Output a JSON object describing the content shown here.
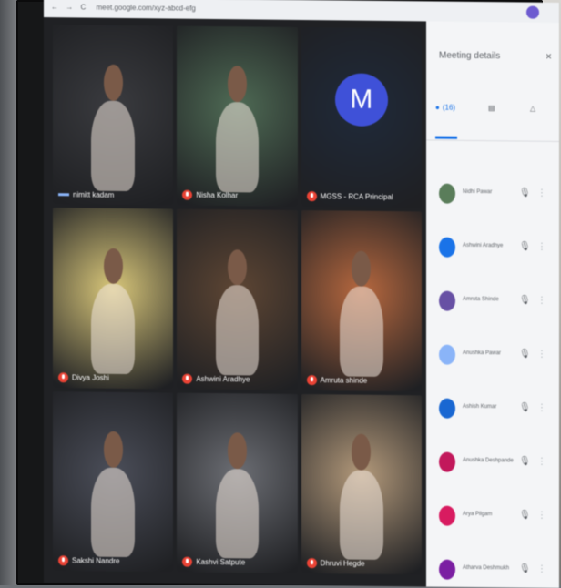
{
  "browser": {
    "nav_icons": "← → C",
    "url": "meet.google.com/xyz-abcd-efg",
    "profile_color": "#6d5bd0"
  },
  "meeting": {
    "tiles": [
      {
        "label": "nimitt kadam",
        "type": "video",
        "bg": "#3a3b3f"
      },
      {
        "label": "Nisha Kolhar",
        "type": "video",
        "bg": "#4f6b55"
      },
      {
        "label": "MGSS - RCA Principal",
        "type": "avatar",
        "initial": "M",
        "bg": "#1f2a3a",
        "avatar_color": "#3f51d8"
      },
      {
        "label": "Divya Joshi",
        "type": "video",
        "bg": "#d9c77a"
      },
      {
        "label": "Ashwini Aradhye",
        "type": "video",
        "bg": "#5e4634"
      },
      {
        "label": "Amruta shinde",
        "type": "video",
        "bg": "#b7683f"
      },
      {
        "label": "Sakshi Nandre",
        "type": "video",
        "bg": "#4b4e59"
      },
      {
        "label": "Kashvi Satpute",
        "type": "video",
        "bg": "#6c6e74"
      },
      {
        "label": "Dhruvi Hegde",
        "type": "video",
        "bg": "#b49a7b"
      }
    ]
  },
  "panel": {
    "title": "Meeting details",
    "close_icon": "close-icon",
    "tabs": [
      {
        "icon": "people-icon",
        "label": "(16)"
      },
      {
        "icon": "chat-icon",
        "label": "▤"
      },
      {
        "icon": "activities-icon",
        "label": "△"
      }
    ],
    "participants": [
      {
        "name": "Nidhi Pawar",
        "color": "#5a7d5a"
      },
      {
        "name": "Ashwini Aradhye",
        "color": "#1a73e8"
      },
      {
        "name": "Amruta Shinde",
        "color": "#6750a4"
      },
      {
        "name": "Anushka Pawar",
        "color": "#8ab4f8"
      },
      {
        "name": "Ashish Kumar",
        "color": "#1967d2"
      },
      {
        "name": "Anushka Deshpande",
        "color": "#c2185b"
      },
      {
        "name": "Arya Pilgam",
        "color": "#d81b60"
      },
      {
        "name": "Atharva Deshmukh",
        "color": "#7b1fa2"
      }
    ],
    "mic_icon": "mic-icon",
    "more_icon": "more-vert-icon"
  }
}
